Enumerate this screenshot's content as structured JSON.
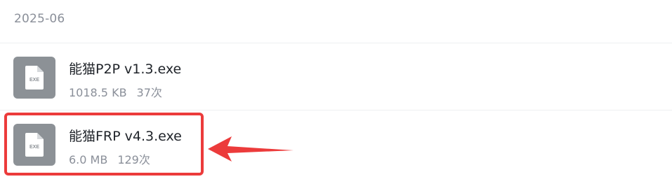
{
  "group": {
    "date_label": "2025-06"
  },
  "files": [
    {
      "name": "能猫P2P v1.3.exe",
      "size": "1018.5 KB",
      "downloads": "37次",
      "icon": "exe-file-icon",
      "icon_label": "EXE"
    },
    {
      "name": "能猫FRP v4.3.exe",
      "size": "6.0 MB",
      "downloads": "129次",
      "icon": "exe-file-icon",
      "icon_label": "EXE"
    }
  ],
  "annotation": {
    "highlight_color": "#ec3b3b",
    "arrow_icon": "left-arrow-annotation-icon"
  },
  "colors": {
    "icon_background": "#8c9196",
    "title_text": "#1f2329",
    "secondary_text": "#8a8f99"
  }
}
